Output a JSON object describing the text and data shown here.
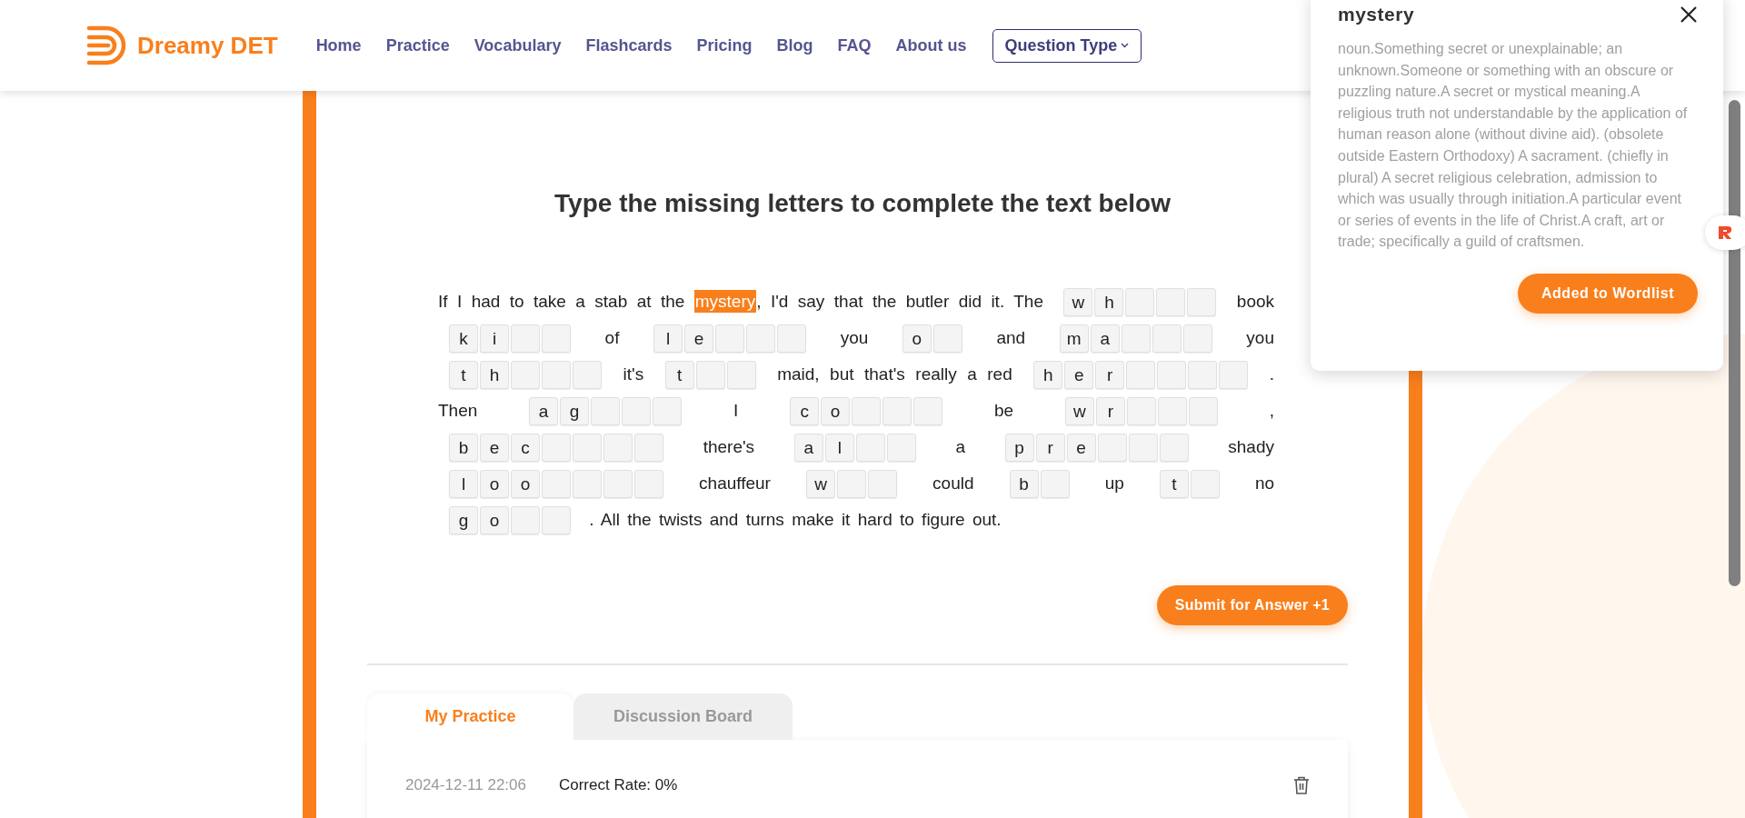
{
  "header": {
    "logo_text": "Dreamy DET",
    "nav": [
      "Home",
      "Practice",
      "Vocabulary",
      "Flashcards",
      "Pricing",
      "Blog",
      "FAQ",
      "About us"
    ],
    "dropdown": "Question Type"
  },
  "exercise": {
    "title": "Type the missing letters to complete the text below",
    "passage": [
      {
        "kind": "text",
        "text": "If I had to take a stab at the"
      },
      {
        "kind": "highlight",
        "text": "mystery"
      },
      {
        "kind": "text",
        "text": ", I'd say that the butler did it. The"
      },
      {
        "kind": "blank",
        "cells": [
          {
            "kind": "given",
            "letter": "w"
          },
          {
            "kind": "given",
            "letter": "h"
          },
          {
            "kind": "empty"
          },
          {
            "kind": "empty"
          },
          {
            "kind": "empty"
          }
        ]
      },
      {
        "kind": "text",
        "text": "book"
      },
      {
        "kind": "blank",
        "cells": [
          {
            "kind": "given",
            "letter": "k"
          },
          {
            "kind": "given",
            "letter": "i"
          },
          {
            "kind": "empty"
          },
          {
            "kind": "empty"
          }
        ]
      },
      {
        "kind": "text",
        "text": "of"
      },
      {
        "kind": "blank",
        "cells": [
          {
            "kind": "given",
            "letter": "l"
          },
          {
            "kind": "given",
            "letter": "e"
          },
          {
            "kind": "empty"
          },
          {
            "kind": "empty"
          },
          {
            "kind": "empty"
          }
        ]
      },
      {
        "kind": "text",
        "text": "you"
      },
      {
        "kind": "blank",
        "cells": [
          {
            "kind": "given",
            "letter": "o"
          },
          {
            "kind": "empty"
          }
        ]
      },
      {
        "kind": "text",
        "text": "and"
      },
      {
        "kind": "blank",
        "cells": [
          {
            "kind": "given",
            "letter": "m"
          },
          {
            "kind": "given",
            "letter": "a"
          },
          {
            "kind": "empty"
          },
          {
            "kind": "empty"
          },
          {
            "kind": "empty"
          }
        ]
      },
      {
        "kind": "text",
        "text": "you"
      },
      {
        "kind": "blank",
        "cells": [
          {
            "kind": "given",
            "letter": "t"
          },
          {
            "kind": "given",
            "letter": "h"
          },
          {
            "kind": "empty"
          },
          {
            "kind": "empty"
          },
          {
            "kind": "empty"
          }
        ]
      },
      {
        "kind": "text",
        "text": "it's"
      },
      {
        "kind": "blank",
        "cells": [
          {
            "kind": "given",
            "letter": "t"
          },
          {
            "kind": "empty"
          },
          {
            "kind": "empty"
          }
        ]
      },
      {
        "kind": "text",
        "text": "maid, but that's really a red"
      },
      {
        "kind": "blank",
        "cells": [
          {
            "kind": "given",
            "letter": "h"
          },
          {
            "kind": "given",
            "letter": "e"
          },
          {
            "kind": "given",
            "letter": "r"
          },
          {
            "kind": "empty"
          },
          {
            "kind": "empty"
          },
          {
            "kind": "empty"
          },
          {
            "kind": "empty"
          }
        ]
      },
      {
        "kind": "text",
        "text": "."
      },
      {
        "kind": "text",
        "text": "Then"
      },
      {
        "kind": "blank",
        "cells": [
          {
            "kind": "given",
            "letter": "a"
          },
          {
            "kind": "given",
            "letter": "g"
          },
          {
            "kind": "empty"
          },
          {
            "kind": "empty"
          },
          {
            "kind": "empty"
          }
        ]
      },
      {
        "kind": "text",
        "text": "I"
      },
      {
        "kind": "blank",
        "cells": [
          {
            "kind": "given",
            "letter": "c"
          },
          {
            "kind": "given",
            "letter": "o"
          },
          {
            "kind": "empty"
          },
          {
            "kind": "empty"
          },
          {
            "kind": "empty"
          }
        ]
      },
      {
        "kind": "text",
        "text": "be"
      },
      {
        "kind": "blank",
        "cells": [
          {
            "kind": "given",
            "letter": "w"
          },
          {
            "kind": "given",
            "letter": "r"
          },
          {
            "kind": "empty"
          },
          {
            "kind": "empty"
          },
          {
            "kind": "empty"
          }
        ]
      },
      {
        "kind": "text",
        "text": ","
      },
      {
        "kind": "blank",
        "cells": [
          {
            "kind": "given",
            "letter": "b"
          },
          {
            "kind": "given",
            "letter": "e"
          },
          {
            "kind": "given",
            "letter": "c"
          },
          {
            "kind": "empty"
          },
          {
            "kind": "empty"
          },
          {
            "kind": "empty"
          },
          {
            "kind": "empty"
          }
        ]
      },
      {
        "kind": "text",
        "text": "there's"
      },
      {
        "kind": "blank",
        "cells": [
          {
            "kind": "given",
            "letter": "a"
          },
          {
            "kind": "given",
            "letter": "l"
          },
          {
            "kind": "empty"
          },
          {
            "kind": "empty"
          }
        ]
      },
      {
        "kind": "text",
        "text": "a"
      },
      {
        "kind": "blank",
        "cells": [
          {
            "kind": "given",
            "letter": "p"
          },
          {
            "kind": "given",
            "letter": "r"
          },
          {
            "kind": "given",
            "letter": "e"
          },
          {
            "kind": "empty"
          },
          {
            "kind": "empty"
          },
          {
            "kind": "empty"
          }
        ]
      },
      {
        "kind": "text",
        "text": "shady"
      },
      {
        "kind": "blank",
        "cells": [
          {
            "kind": "given",
            "letter": "l"
          },
          {
            "kind": "given",
            "letter": "o"
          },
          {
            "kind": "given",
            "letter": "o"
          },
          {
            "kind": "empty"
          },
          {
            "kind": "empty"
          },
          {
            "kind": "empty"
          },
          {
            "kind": "empty"
          }
        ]
      },
      {
        "kind": "text",
        "text": "chauffeur"
      },
      {
        "kind": "blank",
        "cells": [
          {
            "kind": "given",
            "letter": "w"
          },
          {
            "kind": "empty"
          },
          {
            "kind": "empty"
          }
        ]
      },
      {
        "kind": "text",
        "text": "could"
      },
      {
        "kind": "blank",
        "cells": [
          {
            "kind": "given",
            "letter": "b"
          },
          {
            "kind": "empty"
          }
        ]
      },
      {
        "kind": "text",
        "text": "up"
      },
      {
        "kind": "blank",
        "cells": [
          {
            "kind": "given",
            "letter": "t"
          },
          {
            "kind": "empty"
          }
        ]
      },
      {
        "kind": "text",
        "text": "no"
      },
      {
        "kind": "blank",
        "cells": [
          {
            "kind": "given",
            "letter": "g"
          },
          {
            "kind": "given",
            "letter": "o"
          },
          {
            "kind": "empty"
          },
          {
            "kind": "empty"
          }
        ]
      },
      {
        "kind": "text",
        "text": ". All the twists and turns make it hard to figure out."
      }
    ],
    "submit": "Submit for Answer +1"
  },
  "tabs": [
    {
      "label": "My Practice",
      "selected": true
    },
    {
      "label": "Discussion Board",
      "selected": false
    }
  ],
  "records": [
    {
      "date": "2024-12-11 22:06",
      "result": "Correct Rate: 0%"
    }
  ],
  "word_popup": {
    "word": "mystery",
    "definition": "noun.Something secret or unexplainable; an unknown.Someone or something with an obscure or puzzling nature.A secret or mystical meaning.A religious truth not understandable by the application of human reason alone (without divine aid). (obsolete outside Eastern Orthodoxy) A sacrament. (chiefly in plural) A secret religious celebration, admission to which was usually through initiation.A particular event or series of events in the life of Christ.A craft, art or trade; specifically a guild of craftsmen.",
    "button": "Added to Wordlist"
  }
}
